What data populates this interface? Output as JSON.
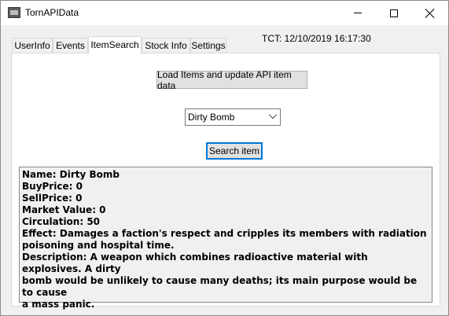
{
  "window": {
    "title": "TornAPIData",
    "icon": "app-icon"
  },
  "tabs": [
    {
      "label": "UserInfo",
      "active": false
    },
    {
      "label": "Events",
      "active": false
    },
    {
      "label": "ItemSearch",
      "active": true
    },
    {
      "label": "Stock Info",
      "active": false
    },
    {
      "label": "Settings",
      "active": false
    }
  ],
  "tct": "TCT: 12/10/2019 16:17:30",
  "item_search": {
    "load_button_label": "Load Items and update API item data",
    "selected_item": "Dirty Bomb",
    "search_button_label": "Search item",
    "result_lines": [
      "Name: Dirty Bomb",
      "BuyPrice: 0",
      "SellPrice: 0",
      "Market Value: 0",
      "Circulation: 50",
      "Effect: Damages a faction's respect and cripples its members with radiation\npoisoning and hospital time.",
      "Description: A weapon which combines radioactive material with explosives. A dirty\nbomb would be unlikely to cause many deaths; its main purpose would be to cause\na mass panic."
    ]
  }
}
